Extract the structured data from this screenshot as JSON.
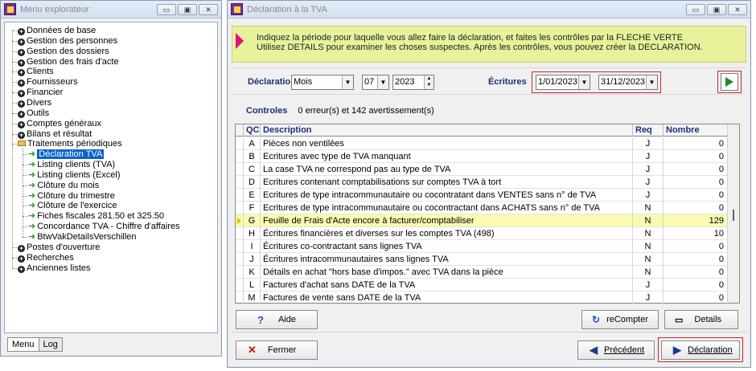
{
  "explorer": {
    "title": "Menu explorateur",
    "tree": [
      {
        "label": "Données de base",
        "icon": "plus-bullet-icon",
        "level": 1
      },
      {
        "label": "Gestion des personnes",
        "icon": "plus-bullet-icon",
        "level": 1
      },
      {
        "label": "Gestion des dossiers",
        "icon": "plus-bullet-icon",
        "level": 1
      },
      {
        "label": "Gestion des frais d'acte",
        "icon": "plus-bullet-icon",
        "level": 1
      },
      {
        "label": "Clients",
        "icon": "plus-bullet-icon",
        "level": 1
      },
      {
        "label": "Fournisseurs",
        "icon": "plus-bullet-icon",
        "level": 1
      },
      {
        "label": "Financier",
        "icon": "plus-bullet-icon",
        "level": 1
      },
      {
        "label": "Divers",
        "icon": "plus-bullet-icon",
        "level": 1
      },
      {
        "label": "Outils",
        "icon": "plus-bullet-icon",
        "level": 1
      },
      {
        "label": "Comptes généraux",
        "icon": "plus-bullet-icon",
        "level": 1
      },
      {
        "label": "Bilans et résultat",
        "icon": "plus-bullet-icon",
        "level": 1
      },
      {
        "label": "Traitements périodiques",
        "icon": "open-folder-icon",
        "level": 1
      },
      {
        "label": "Déclaration TVA",
        "icon": "green-arrow-icon",
        "level": 2,
        "selected": true
      },
      {
        "label": "Listing clients (TVA)",
        "icon": "green-arrow-icon",
        "level": 2
      },
      {
        "label": "Listing clients (Excel)",
        "icon": "green-arrow-icon",
        "level": 2
      },
      {
        "label": "Clôture du mois",
        "icon": "green-arrow-icon",
        "level": 2
      },
      {
        "label": "Clôture du trimestre",
        "icon": "green-arrow-icon",
        "level": 2
      },
      {
        "label": "Clôture de l'exercice",
        "icon": "green-arrow-icon",
        "level": 2
      },
      {
        "label": "Fiches fiscales 281.50 et 325.50",
        "icon": "green-arrow-icon",
        "level": 2
      },
      {
        "label": "Concordance TVA - Chiffre d'affaires",
        "icon": "green-arrow-icon",
        "level": 2
      },
      {
        "label": "BtwVakDetailsVerschillen",
        "icon": "green-arrow-icon",
        "level": 2
      },
      {
        "label": "Postes d'ouverture",
        "icon": "plus-bullet-icon",
        "level": 1
      },
      {
        "label": "Recherches",
        "icon": "plus-bullet-icon",
        "level": 1
      },
      {
        "label": "Anciennes listes",
        "icon": "plus-bullet-icon",
        "level": 1
      }
    ],
    "tabs": [
      "Menu",
      "Log"
    ]
  },
  "dialog": {
    "title": "Déclaration à la TVA",
    "banner_line1": "Indiquez la période pour laquelle vous allez faire la déclaration, et faites les contrôles par la FLECHE VERTE",
    "banner_line2": "Utilisez DETAILS pour examiner les choses suspectes.  Après les contrôles, vous pouvez créer la DECLARATION.",
    "declaration_label": "Déclaration",
    "period_type": "Mois",
    "month": "07",
    "year": "2023",
    "ecritures_label": "Écritures",
    "date_from": "1/01/2023",
    "date_to": "31/12/2023",
    "controls_label": "Controles",
    "controls_summary": "0 erreur(s) et 142 avertissement(s)",
    "columns": [
      "QC",
      "Description",
      "Req",
      "Nombre"
    ],
    "rows": [
      {
        "qc": "A",
        "desc": "Pièces non ventilées",
        "req": "J",
        "nombre": "0"
      },
      {
        "qc": "B",
        "desc": "Ecritures avec type de TVA manquant",
        "req": "J",
        "nombre": "0"
      },
      {
        "qc": "C",
        "desc": "La case TVA ne correspond pas au type de TVA",
        "req": "J",
        "nombre": "0"
      },
      {
        "qc": "D",
        "desc": "Ecritures contenant comptabilisations sur comptes TVA à tort",
        "req": "J",
        "nombre": "0"
      },
      {
        "qc": "E",
        "desc": "Ecritures de type intracommunautaire ou cocontratant dans VENTES sans n° de TVA",
        "req": "J",
        "nombre": "0"
      },
      {
        "qc": "F",
        "desc": "Ecritures de type intracommunautaire ou cocontractant dans ACHATS sans n° de TVA",
        "req": "N",
        "nombre": "0"
      },
      {
        "qc": "G",
        "desc": "Feuille de Frais d'Acte encore à facturer/comptabiliser",
        "req": "N",
        "nombre": "129",
        "highlight": true
      },
      {
        "qc": "H",
        "desc": "Écritures financières et diverses sur les comptes TVA (498)",
        "req": "N",
        "nombre": "10"
      },
      {
        "qc": "I",
        "desc": "Écritures co-contractant sans lignes TVA",
        "req": "N",
        "nombre": "0"
      },
      {
        "qc": "J",
        "desc": "Écritures intracommunautaires sans lignes TVA",
        "req": "N",
        "nombre": "0"
      },
      {
        "qc": "K",
        "desc": "Détails en achat \"hors base d'impos.\" avec TVA dans la pièce",
        "req": "N",
        "nombre": "0"
      },
      {
        "qc": "L",
        "desc": "Factures d'achat sans DATE de la TVA",
        "req": "J",
        "nombre": "0"
      },
      {
        "qc": "M",
        "desc": "Factures de vente sans DATE de la TVA",
        "req": "J",
        "nombre": "0"
      }
    ],
    "buttons": {
      "aide": "Aide",
      "recompter": "reCompter",
      "details": "Details",
      "fermer": "Fermer",
      "precedent": "Précédent",
      "declaration": "Déclaration"
    },
    "colors": {
      "banner": "#e7f29a",
      "accent_pink": "#e0107f",
      "go_green": "#1e8b1e",
      "highlight_row": "#fafab0"
    }
  }
}
